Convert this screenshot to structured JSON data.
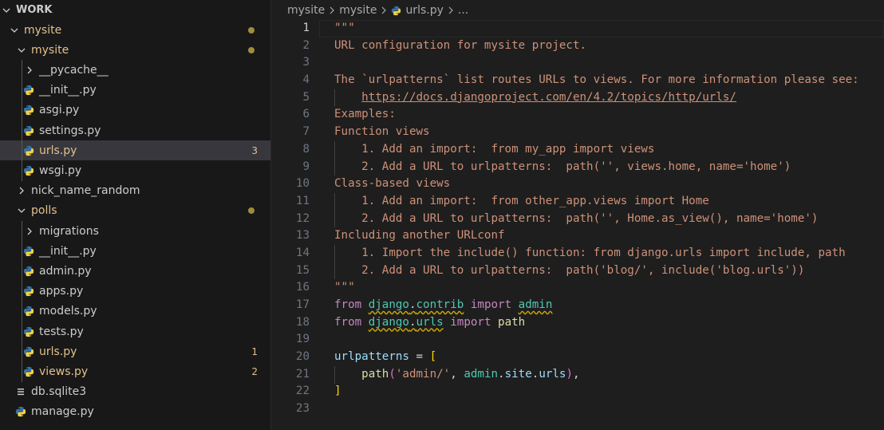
{
  "explorer": {
    "root": "WORK",
    "items": [
      {
        "label": "mysite",
        "kind": "folder-open",
        "depth": 1,
        "status": "dot",
        "color": "modified"
      },
      {
        "label": "mysite",
        "kind": "folder-open",
        "depth": 2,
        "status": "dot",
        "color": "modified"
      },
      {
        "label": "__pycache__",
        "kind": "folder-closed",
        "depth": 3,
        "color": "normal"
      },
      {
        "label": "__init__.py",
        "kind": "python",
        "depth": 3,
        "color": "normal"
      },
      {
        "label": "asgi.py",
        "kind": "python",
        "depth": 3,
        "color": "normal"
      },
      {
        "label": "settings.py",
        "kind": "python",
        "depth": 3,
        "color": "normal"
      },
      {
        "label": "urls.py",
        "kind": "python",
        "depth": 3,
        "color": "modified",
        "badge": "3",
        "selected": true
      },
      {
        "label": "wsgi.py",
        "kind": "python",
        "depth": 3,
        "color": "normal"
      },
      {
        "label": "nick_name_random",
        "kind": "folder-closed",
        "depth": 2,
        "color": "normal"
      },
      {
        "label": "polls",
        "kind": "folder-open",
        "depth": 2,
        "status": "dot",
        "color": "modified"
      },
      {
        "label": "migrations",
        "kind": "folder-closed",
        "depth": 3,
        "color": "normal"
      },
      {
        "label": "__init__.py",
        "kind": "python",
        "depth": 3,
        "color": "normal"
      },
      {
        "label": "admin.py",
        "kind": "python",
        "depth": 3,
        "color": "normal"
      },
      {
        "label": "apps.py",
        "kind": "python",
        "depth": 3,
        "color": "normal"
      },
      {
        "label": "models.py",
        "kind": "python",
        "depth": 3,
        "color": "normal"
      },
      {
        "label": "tests.py",
        "kind": "python",
        "depth": 3,
        "color": "normal"
      },
      {
        "label": "urls.py",
        "kind": "python",
        "depth": 3,
        "color": "modified",
        "badge": "1"
      },
      {
        "label": "views.py",
        "kind": "python",
        "depth": 3,
        "color": "modified",
        "badge": "2"
      },
      {
        "label": "db.sqlite3",
        "kind": "database",
        "depth": 2,
        "color": "normal"
      },
      {
        "label": "manage.py",
        "kind": "python",
        "depth": 2,
        "color": "normal"
      }
    ]
  },
  "breadcrumb": {
    "parts": [
      "mysite",
      "mysite",
      "urls.py",
      "..."
    ]
  },
  "editor": {
    "active_line": 1,
    "lines": [
      [
        {
          "t": "\"\"\"",
          "c": "s"
        }
      ],
      [
        {
          "t": "URL configuration for mysite project.",
          "c": "s"
        }
      ],
      [
        {
          "t": "",
          "c": "s"
        }
      ],
      [
        {
          "t": "The `urlpatterns` list routes URLs to views. For more information please see:",
          "c": "s"
        }
      ],
      [
        {
          "t": "    ",
          "c": "s"
        },
        {
          "t": "https://docs.djangoproject.com/en/4.2/topics/http/urls/",
          "c": "s u"
        }
      ],
      [
        {
          "t": "Examples:",
          "c": "s"
        }
      ],
      [
        {
          "t": "Function views",
          "c": "s"
        }
      ],
      [
        {
          "t": "    1. Add an import:  from my_app import views",
          "c": "s"
        }
      ],
      [
        {
          "t": "    2. Add a URL to urlpatterns:  path('', views.home, name='home')",
          "c": "s"
        }
      ],
      [
        {
          "t": "Class-based views",
          "c": "s"
        }
      ],
      [
        {
          "t": "    1. Add an import:  from other_app.views import Home",
          "c": "s"
        }
      ],
      [
        {
          "t": "    2. Add a URL to urlpatterns:  path('', Home.as_view(), name='home')",
          "c": "s"
        }
      ],
      [
        {
          "t": "Including another URLconf",
          "c": "s"
        }
      ],
      [
        {
          "t": "    1. Import the include() function: from django.urls import include, path",
          "c": "s"
        }
      ],
      [
        {
          "t": "    2. Add a URL to urlpatterns:  path('blog/', include('blog.urls'))",
          "c": "s"
        }
      ],
      [
        {
          "t": "\"\"\"",
          "c": "s"
        }
      ],
      [
        {
          "t": "from",
          "c": "k"
        },
        {
          "t": " ",
          "c": "p"
        },
        {
          "t": "django",
          "c": "m sq"
        },
        {
          "t": ".",
          "c": "p sq"
        },
        {
          "t": "contrib",
          "c": "m sq"
        },
        {
          "t": " ",
          "c": "p"
        },
        {
          "t": "import",
          "c": "k"
        },
        {
          "t": " ",
          "c": "p"
        },
        {
          "t": "admin",
          "c": "m sq"
        }
      ],
      [
        {
          "t": "from",
          "c": "k"
        },
        {
          "t": " ",
          "c": "p"
        },
        {
          "t": "django",
          "c": "m sq"
        },
        {
          "t": ".",
          "c": "p sq"
        },
        {
          "t": "urls",
          "c": "m sq"
        },
        {
          "t": " ",
          "c": "p"
        },
        {
          "t": "import",
          "c": "k"
        },
        {
          "t": " ",
          "c": "p"
        },
        {
          "t": "path",
          "c": "f"
        }
      ],
      [
        {
          "t": "",
          "c": "p"
        }
      ],
      [
        {
          "t": "urlpatterns",
          "c": "v"
        },
        {
          "t": " = ",
          "c": "p"
        },
        {
          "t": "[",
          "c": "b1"
        }
      ],
      [
        {
          "t": "    ",
          "c": "p"
        },
        {
          "t": "path",
          "c": "f"
        },
        {
          "t": "(",
          "c": "b2"
        },
        {
          "t": "'admin/'",
          "c": "s"
        },
        {
          "t": ", ",
          "c": "p"
        },
        {
          "t": "admin",
          "c": "m"
        },
        {
          "t": ".",
          "c": "p"
        },
        {
          "t": "site",
          "c": "v"
        },
        {
          "t": ".",
          "c": "p"
        },
        {
          "t": "urls",
          "c": "v"
        },
        {
          "t": ")",
          "c": "b2"
        },
        {
          "t": ",",
          "c": "p"
        }
      ],
      [
        {
          "t": "]",
          "c": "b1"
        }
      ],
      [
        {
          "t": "",
          "c": "p"
        }
      ]
    ]
  },
  "colors": {
    "modified": "#e2c08d",
    "normal": "#cccccc",
    "python_blue": "#3572a5",
    "python_yellow": "#f0d24a"
  }
}
